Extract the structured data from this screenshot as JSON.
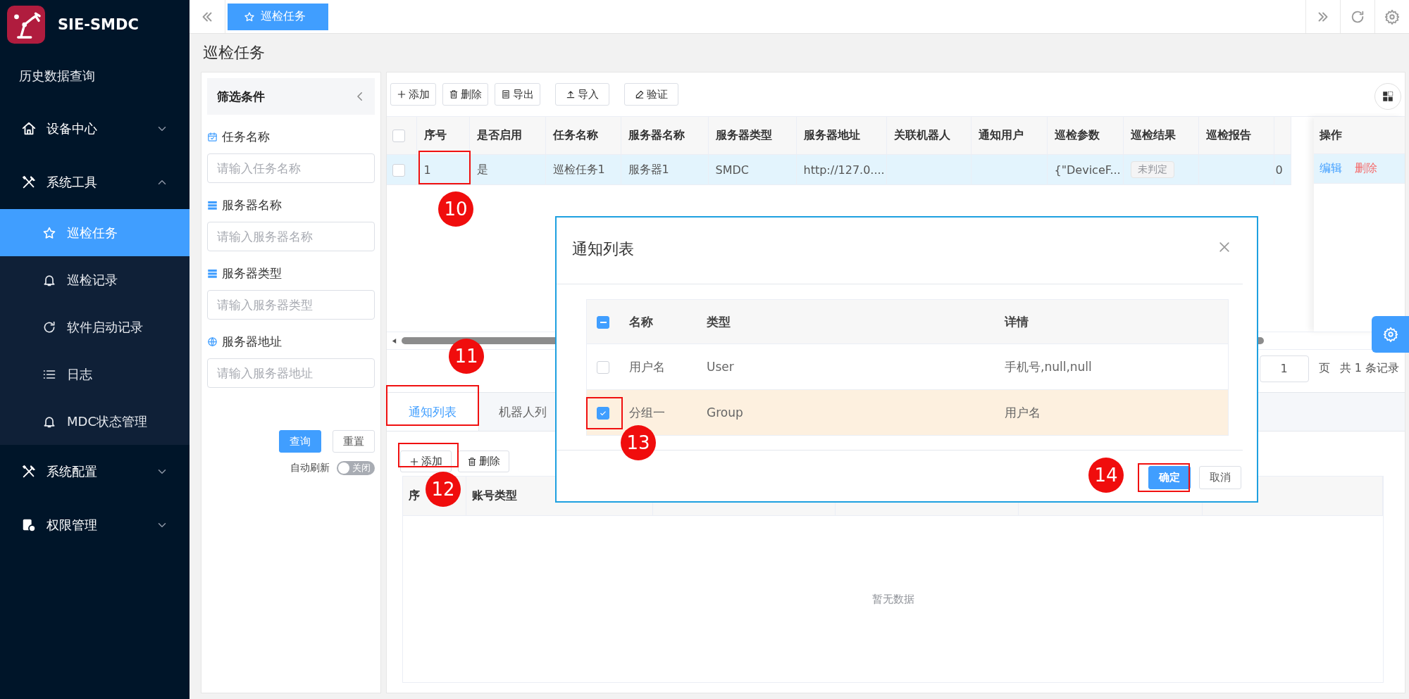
{
  "app": {
    "title": "SIE-SMDC"
  },
  "sidebar": {
    "items": [
      {
        "label": "历史数据查询",
        "kind": "plain"
      },
      {
        "label": "设备中心",
        "kind": "group",
        "expanded": false
      },
      {
        "label": "系统工具",
        "kind": "group",
        "expanded": true,
        "children": [
          {
            "label": "巡检任务",
            "selected": true
          },
          {
            "label": "巡检记录",
            "selected": false
          },
          {
            "label": "软件启动记录",
            "selected": false
          },
          {
            "label": "日志",
            "selected": false
          },
          {
            "label": "MDC状态管理",
            "selected": false
          }
        ]
      },
      {
        "label": "系统配置",
        "kind": "group",
        "expanded": false
      },
      {
        "label": "权限管理",
        "kind": "group",
        "expanded": false
      }
    ]
  },
  "top_bar": {
    "tabs": [
      {
        "label": "巡检任务",
        "selected": true
      }
    ]
  },
  "page_title": "巡检任务",
  "filter": {
    "title": "筛选条件",
    "fields": [
      {
        "label": "任务名称",
        "placeholder": "请输入任务名称"
      },
      {
        "label": "服务器名称",
        "placeholder": "请输入服务器名称"
      },
      {
        "label": "服务器类型",
        "placeholder": "请输入服务器类型"
      },
      {
        "label": "服务器地址",
        "placeholder": "请输入服务器地址"
      }
    ],
    "buttons": [
      {
        "label": "查询",
        "kind": "primary"
      },
      {
        "label": "重置",
        "kind": "default"
      }
    ],
    "auto_refresh": {
      "label": "自动刷新",
      "on": false,
      "state_text": "关闭"
    }
  },
  "toolbar": [
    {
      "label": "添加",
      "kind": "add"
    },
    {
      "label": "删除",
      "kind": "delete"
    },
    {
      "label": "导出",
      "kind": "export"
    },
    {
      "label": "导入",
      "kind": "import"
    },
    {
      "label": "验证",
      "kind": "verify"
    }
  ],
  "table": {
    "columns": [
      "序号",
      "是否启用",
      "任务名称",
      "服务器名称",
      "服务器类型",
      "服务器地址",
      "关联机器人",
      "通知用户",
      "巡检参数",
      "巡检结果",
      "巡检报告"
    ],
    "action_column": "操作",
    "select_all_checked": false,
    "rows": [
      {
        "selected": true,
        "checked": false,
        "cells": [
          {
            "text": "1",
            "kind": "text"
          },
          {
            "text": "是",
            "kind": "text"
          },
          {
            "text": "巡检任务1",
            "kind": "text"
          },
          {
            "text": "服务器1",
            "kind": "text"
          },
          {
            "text": "SMDC",
            "kind": "text"
          },
          {
            "text": "http://127.0....",
            "kind": "text"
          },
          {
            "text": "",
            "kind": "empty"
          },
          {
            "text": "",
            "kind": "empty"
          },
          {
            "text": "{\"DeviceF...",
            "kind": "text"
          },
          {
            "text": "未判定",
            "kind": "tag"
          },
          {
            "text": "",
            "kind": "empty"
          },
          {
            "text": "0",
            "kind": "text"
          }
        ],
        "actions": [
          {
            "label": "编辑",
            "kind": "edit"
          },
          {
            "label": "删除",
            "kind": "delete"
          }
        ]
      }
    ]
  },
  "pagination": {
    "page": "1",
    "page_unit": "页",
    "total": "共 1 条记录"
  },
  "detail_tabs": [
    {
      "label": "通知列表",
      "selected": true
    },
    {
      "label": "机器人列",
      "selected": false
    }
  ],
  "detail_toolbar": [
    {
      "label": "添加",
      "kind": "add"
    },
    {
      "label": "删除",
      "kind": "delete"
    }
  ],
  "detail_table": {
    "columns": [
      "序",
      "账号类型"
    ],
    "empty_text": "暂无数据"
  },
  "dialog": {
    "title": "通知列表",
    "select_all_indeterminate": true,
    "columns": [
      "名称",
      "类型",
      "详情"
    ],
    "rows": [
      {
        "checked": false,
        "cells": [
          "用户名",
          "User",
          "手机号,null,null"
        ]
      },
      {
        "checked": true,
        "cells": [
          "分组一",
          "Group",
          "用户名"
        ]
      }
    ],
    "buttons": [
      {
        "label": "确定",
        "kind": "primary"
      },
      {
        "label": "取消",
        "kind": "default"
      }
    ]
  },
  "annotations": [
    {
      "label": "10"
    },
    {
      "label": "11"
    },
    {
      "label": "12"
    },
    {
      "label": "13"
    },
    {
      "label": "14"
    }
  ]
}
